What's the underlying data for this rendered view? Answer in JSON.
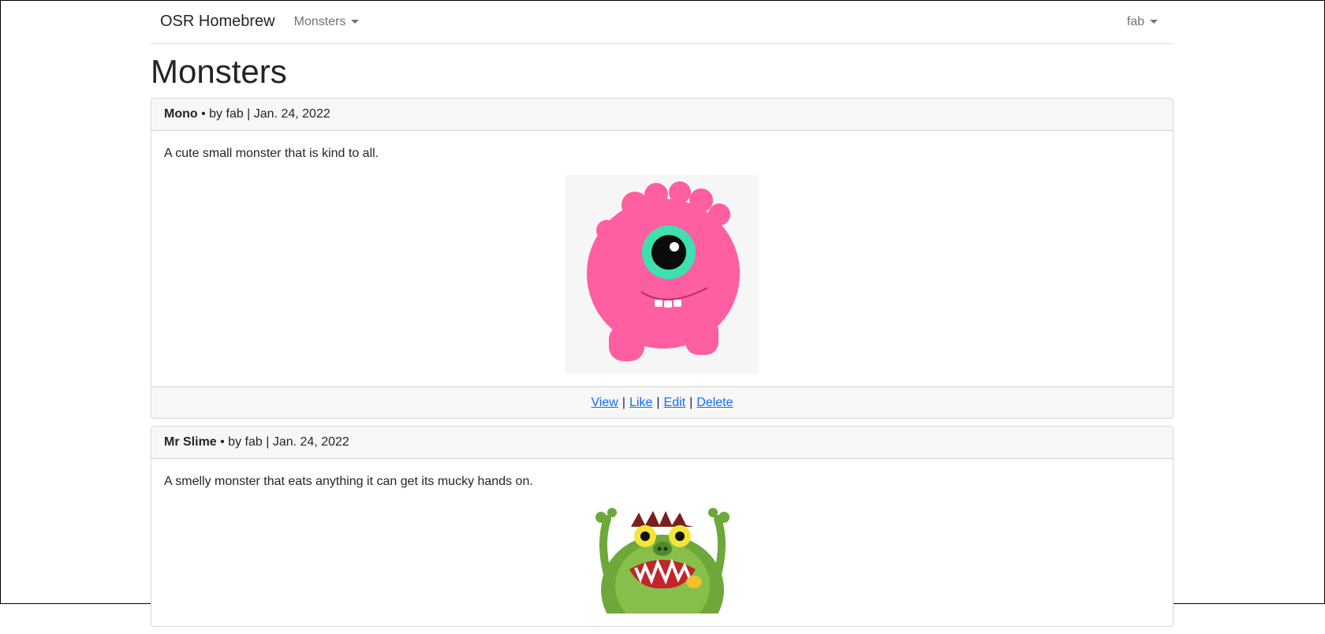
{
  "navbar": {
    "brand": "OSR Homebrew",
    "menu_label": "Monsters",
    "user_label": "fab"
  },
  "page": {
    "title": "Monsters"
  },
  "monsters": [
    {
      "name": "Mono",
      "meta": " • by fab | Jan. 24, 2022",
      "description": "A cute small monster that is kind to all.",
      "image_icon": "pink-one-eyed-monster-icon",
      "actions": {
        "view": "View",
        "like": "Like",
        "edit": "Edit",
        "delete": "Delete"
      }
    },
    {
      "name": "Mr Slime",
      "meta": " • by fab | Jan. 24, 2022",
      "description": "A smelly monster that eats anything it can get its mucky hands on.",
      "image_icon": "green-slime-monster-icon"
    }
  ],
  "colors": {
    "link": "#0d6efd",
    "pink_monster": "#ff5ea0",
    "eye_ring": "#3ee0b0",
    "slime_green": "#6fa83a"
  }
}
